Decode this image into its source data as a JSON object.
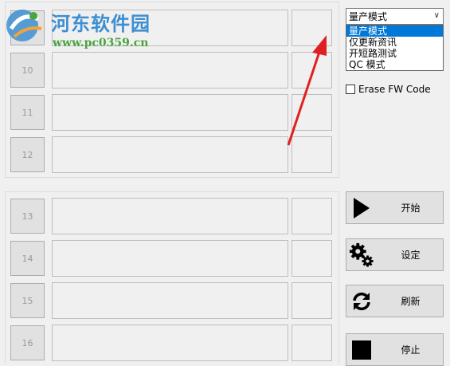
{
  "ports_group_a": [
    {
      "number": ""
    },
    {
      "number": "10"
    },
    {
      "number": "11"
    },
    {
      "number": "12"
    }
  ],
  "ports_group_b": [
    {
      "number": "13"
    },
    {
      "number": "14"
    },
    {
      "number": "15"
    },
    {
      "number": "16"
    }
  ],
  "mode_select": {
    "selected": "量产模式",
    "options": [
      "量产模式",
      "仅更新资讯",
      "开短路测试",
      "QC 模式"
    ]
  },
  "erase_fw": {
    "label": "Erase FW Code",
    "checked": false
  },
  "actions": {
    "start": "开始",
    "settings": "设定",
    "refresh": "刷新",
    "stop": "停止"
  },
  "watermark": {
    "title": "河东软件园",
    "url": "www.pc0359.cn"
  },
  "colors": {
    "watermark_blue": "#3d8fd1",
    "watermark_green": "#4aa43f",
    "selection_blue": "#0078d7",
    "annotation_red": "#e02020"
  }
}
